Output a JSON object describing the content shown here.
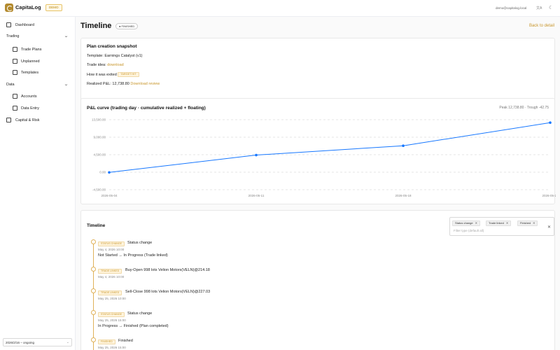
{
  "app": {
    "brand": "CapitaLog",
    "badge": "DEMO",
    "user_email": "demo@capitalog.local",
    "lang_icon": "文A",
    "theme_icon": "☾"
  },
  "sidebar": {
    "dashboard": "Dashboard",
    "trading_group": "Trading",
    "trade_plans": "Trade Plans",
    "unplanned": "Unplanned",
    "templates": "Templates",
    "data_group": "Data",
    "accounts": "Accounts",
    "data_entry": "Data Entry",
    "capital_risk": "Capital & Risk",
    "project_select": "2026/2/16 – ongoing"
  },
  "page": {
    "title": "Timeline",
    "status": "● FINISHED",
    "back": "Back to detail"
  },
  "snapshot": {
    "title": "Plan creation snapshot",
    "template_label": "Template:",
    "template_value": "Earnings Catalyst  (v1)",
    "idea_label": "Trade idea:",
    "idea_link": "download",
    "exit_label": "How it was exited",
    "exit_tag": "TARGET HIT",
    "pnl_label": "Realized P&L: 12,738.80",
    "pnl_link": "Download review"
  },
  "chart": {
    "title": "P&L curve (trading day · cumulative realized + floating)",
    "peak_text": "Peak 12,738.80 · Trough -42.75",
    "y_ticks": [
      "13,500.00",
      "9,000.00",
      "4,500.00",
      "0.00",
      "-4,500.00"
    ],
    "x_ticks": [
      "2026-05-04",
      "2026-05-11",
      "2026-05-18",
      "2026-05-25"
    ]
  },
  "chart_data": {
    "type": "line",
    "title": "P&L curve (trading day · cumulative realized + floating)",
    "x": [
      "2026-05-04",
      "2026-05-11",
      "2026-05-18",
      "2026-05-25"
    ],
    "series": [
      {
        "values": [
          -42.75,
          4400,
          6800,
          12738.8
        ]
      }
    ],
    "ylim": [
      -4500,
      13500
    ],
    "grid": true
  },
  "timeline": {
    "title": "Timeline",
    "filter_chips": [
      "Status change",
      "Trade linked",
      "Finished"
    ],
    "filter_placeholder": "Filter type (default all)",
    "events": [
      {
        "tag": "STATUS CHANGE",
        "title": "Status change",
        "time": "May 4, 2026 10:00",
        "desc": "Not Started → In Progress (Trade linked)"
      },
      {
        "tag": "TRADE LINKED",
        "title": "Buy-Open 998 lots Velion Motors(VELN)@214.18",
        "time": "May 4, 2026 10:00",
        "desc": ""
      },
      {
        "tag": "TRADE LINKED",
        "title": "Sell-Close 998 lots Velion Motors(VELN)@227.03",
        "time": "May 25, 2026 10:00",
        "desc": ""
      },
      {
        "tag": "STATUS CHANGE",
        "title": "Status change",
        "time": "May 25, 2026 15:00",
        "desc": "In Progress → Finished (Plan completed)"
      },
      {
        "tag": "FINISHED",
        "title": "Finished",
        "time": "May 25, 2026 15:00",
        "desc": ""
      }
    ]
  }
}
